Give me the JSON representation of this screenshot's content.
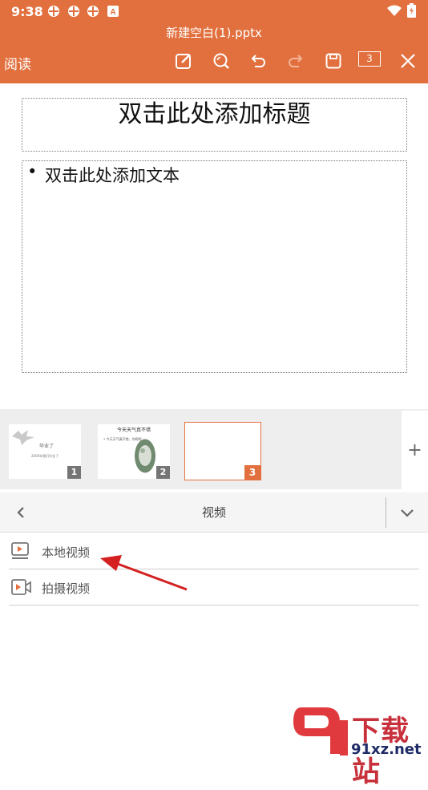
{
  "status_bar": {
    "time": "9:38",
    "notif_icons": [
      "snowflake-icon",
      "snowflake-icon",
      "snowflake-icon",
      "a-badge-icon"
    ],
    "battery_icon": "battery-icon",
    "wifi_icon": "wifi-icon"
  },
  "topbar": {
    "title": "新建空白(1).pptx",
    "read_label": "阅读",
    "toolbar_icons": [
      "edit-icon",
      "search-icon",
      "undo-icon",
      "redo-icon",
      "save-icon",
      "page-count-icon",
      "close-icon"
    ],
    "page_count": "3",
    "accent_color": "#E2703E"
  },
  "slide": {
    "title_placeholder": "双击此处添加标题",
    "bullet": "•",
    "body_placeholder": "双击此处添加文本"
  },
  "thumbnails": [
    {
      "number": "1",
      "caption1": "毕业了",
      "caption2": "2000年我们毕业了"
    },
    {
      "number": "2",
      "title": "今天天气真不错",
      "text": "• 今天天气真不错，你呢呢"
    },
    {
      "number": "3"
    }
  ],
  "add_slide_label": "+",
  "panel": {
    "title": "视频",
    "items": [
      {
        "label": "本地视频",
        "icon": "local-video-icon"
      },
      {
        "label": "拍摄视频",
        "icon": "camera-video-icon"
      }
    ]
  },
  "watermark": {
    "text": "下载站",
    "url": "91xz.net"
  }
}
